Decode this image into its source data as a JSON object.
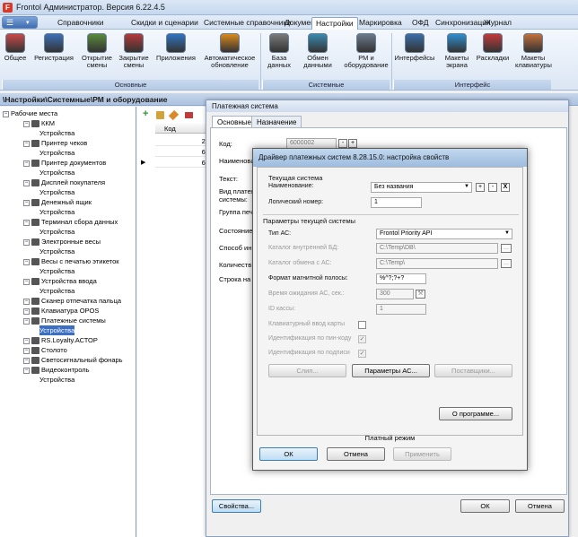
{
  "window": {
    "title": "Frontol Администратор. Версия 6.22.4.5",
    "logo": "F"
  },
  "menu": {
    "tabs": [
      "Справочники",
      "Скидки и сценарии",
      "Системные справочники",
      "Документы",
      "Настройки",
      "Маркировка",
      "ОФД",
      "Синхронизация",
      "Журнал"
    ],
    "active": "Настройки"
  },
  "ribbon": {
    "buttons": [
      {
        "label1": "Общее",
        "label2": "",
        "icon": "gear-icon",
        "color": "#c94a4a"
      },
      {
        "label1": "Регистрация",
        "label2": "",
        "icon": "register-icon",
        "color": "#3d6fb8"
      },
      {
        "label1": "Открытие",
        "label2": "смены",
        "icon": "open-shift-icon",
        "color": "#5a8b3c"
      },
      {
        "label1": "Закрытие",
        "label2": "смены",
        "icon": "close-shift-icon",
        "color": "#b33a3a"
      },
      {
        "label1": "Приложения",
        "label2": "",
        "icon": "apps-icon",
        "color": "#2f74c0"
      },
      {
        "label1": "Автоматическое",
        "label2": "обновление",
        "icon": "auto-update-icon",
        "color": "#d88a1c"
      },
      {
        "label1": "База",
        "label2": "данных",
        "icon": "database-icon",
        "color": "#7a7a7a"
      },
      {
        "label1": "Обмен",
        "label2": "данными",
        "icon": "data-exchange-icon",
        "color": "#3a8ab0"
      },
      {
        "label1": "РМ и",
        "label2": "оборудование",
        "icon": "workstation-icon",
        "color": "#6a7a8a"
      },
      {
        "label1": "Интерфейсы",
        "label2": "",
        "icon": "interfaces-icon",
        "color": "#3b6ea8"
      },
      {
        "label1": "Макеты",
        "label2": "экрана",
        "icon": "screen-layouts-icon",
        "color": "#2f8fd0"
      },
      {
        "label1": "Раскладки",
        "label2": "",
        "icon": "layouts-icon",
        "color": "#c23b3b"
      },
      {
        "label1": "Макеты",
        "label2": "клавиатуры",
        "icon": "keyboard-layouts-icon",
        "color": "#c2703b"
      }
    ],
    "groups": [
      "Основные",
      "Системные",
      "Интерфейс"
    ]
  },
  "path": "\\Настройки\\Системные\\РМ и оборудование",
  "tree": {
    "root": "Рабочие места",
    "items": [
      {
        "label": "ККМ",
        "level": 1
      },
      {
        "label": "Устройства",
        "level": 2
      },
      {
        "label": "Принтер чеков",
        "level": 1
      },
      {
        "label": "Устройства",
        "level": 2
      },
      {
        "label": "Принтер документов",
        "level": 1
      },
      {
        "label": "Устройства",
        "level": 2
      },
      {
        "label": "Дисплей покупателя",
        "level": 1
      },
      {
        "label": "Устройства",
        "level": 2
      },
      {
        "label": "Денежный ящик",
        "level": 1
      },
      {
        "label": "Устройства",
        "level": 2
      },
      {
        "label": "Терминал сбора данных",
        "level": 1
      },
      {
        "label": "Устройства",
        "level": 2
      },
      {
        "label": "Электронные весы",
        "level": 1
      },
      {
        "label": "Устройства",
        "level": 2
      },
      {
        "label": "Весы с печатью этикеток",
        "level": 1
      },
      {
        "label": "Устройства",
        "level": 2
      },
      {
        "label": "Устройства ввода",
        "level": 1
      },
      {
        "label": "Устройства",
        "level": 2
      },
      {
        "label": "Сканер отпечатка пальца",
        "level": 1
      },
      {
        "label": "Клавиатура OPOS",
        "level": 1
      },
      {
        "label": "Платежные системы",
        "level": 1
      },
      {
        "label": "Устройства",
        "level": 2
      },
      {
        "label": "RS.Loyalty.АСТОР",
        "level": 1
      },
      {
        "label": "Столото",
        "level": 1
      },
      {
        "label": "Светосигнальный фонарь",
        "level": 1
      },
      {
        "label": "Видеоконтроль",
        "level": 1
      },
      {
        "label": "Устройства",
        "level": 2
      }
    ],
    "selected": 21
  },
  "grid": {
    "header": "Код",
    "rows": [
      "20",
      "60",
      "60"
    ]
  },
  "payment": {
    "title": "Платежная система",
    "tabs": [
      "Основные",
      "Назначение"
    ],
    "labels": {
      "code": "Код:",
      "name": "Наименован",
      "text": "Текст:",
      "vid1": "Вид платеж",
      "vid2": "системы:",
      "group": "Группа печ",
      "state": "Состояние",
      "method": "Способ ин",
      "qty": "Количеств",
      "row": "Строка на"
    },
    "code_value": "6000002",
    "props_button": "Свойства...",
    "ok": "ОК",
    "cancel": "Отмена"
  },
  "driver": {
    "title": "Драйвер платежных систем 8.28.15.0: настройка свойств",
    "current_section": "Текущая система",
    "name_label": "Наименование:",
    "name_value": "Без названия",
    "logical_label": "Логический номер:",
    "logical_value": "1",
    "params_section": "Параметры текущей системы",
    "type_label": "Тип АС:",
    "type_value": "Frontol Priority API",
    "catalog_db_label": "Каталог внутренней БД:",
    "catalog_db_value": "C:\\Temp\\DB\\",
    "catalog_exch_label": "Каталог обмена с АС:",
    "catalog_exch_value": "C:\\Temp\\",
    "mag_label": "Формат магнитной полосы:",
    "mag_value": "%^?;?+?",
    "wait_label": "Время ожидания АС, сек.:",
    "wait_value": "300",
    "id_label": "ID кассы:",
    "id_value": "1",
    "kbd_label": "Клавиатурный ввод карты",
    "pin_label": "Идентификация по пин-коду",
    "sign_label": "Идентификация по подписи",
    "slip_button": "Слип...",
    "params_button": "Параметры АС...",
    "vendors_button": "Поставщики...",
    "about_button": "О программе...",
    "mode": "Платный режим",
    "ok": "ОК",
    "cancel": "Отмена",
    "apply": "Применить",
    "plus": "+",
    "minus": "-",
    "close": "X",
    "ellipsis": "...",
    "dropdown": "▼",
    "check": "✓",
    "tools": "⚒"
  }
}
